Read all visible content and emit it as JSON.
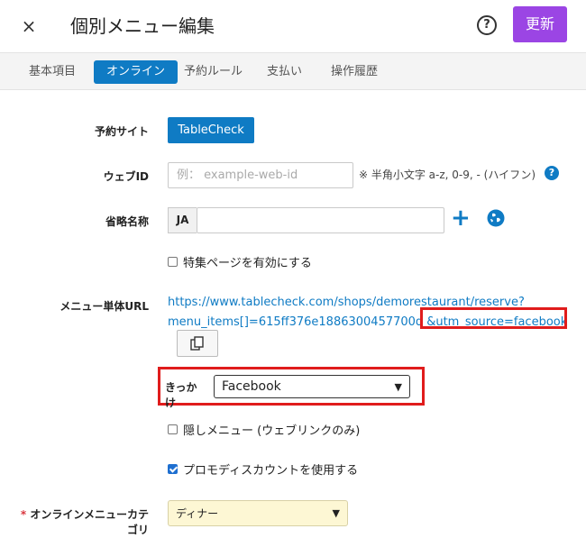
{
  "header": {
    "close": "×",
    "title": "個別メニュー編集",
    "help": "?",
    "update": "更新"
  },
  "tabs": [
    {
      "label": "基本項目"
    },
    {
      "label": "オンライン"
    },
    {
      "label": "予約ルール"
    },
    {
      "label": "支払い"
    },
    {
      "label": "操作履歴"
    }
  ],
  "form": {
    "site_label": "予約サイト",
    "site_value": "TableCheck",
    "webid_label": "ウェブID",
    "webid_placeholder": "例： example-web-id",
    "webid_hint": "※ 半角小文字 a-z, 0-9, - (ハイフン)",
    "shortname_label": "省略名称",
    "lang": "JA",
    "shortname_value": "",
    "feature_page_label": "特集ページを有効にする",
    "url_label": "メニュー単体URL",
    "url_line1": "https://www.tablecheck.com/shops/demorestaurant/reserve?",
    "url_line2_a": "menu_items[]=615ff376e1886300457700d",
    "url_line2_b": "&utm_source=facebook",
    "kikkake_label": "きっかけ",
    "kikkake_value": "Facebook",
    "hidden_menu_label": "隠しメニュー (ウェブリンクのみ)",
    "promo_label": "プロモディスカウントを使用する",
    "category_required": "*",
    "category_label": "オンラインメニューカテゴリ",
    "category_value": "ディナー"
  },
  "colors": {
    "accent": "#0f7bc4",
    "update_button": "#9b45e4",
    "highlight": "#e01c1c"
  }
}
